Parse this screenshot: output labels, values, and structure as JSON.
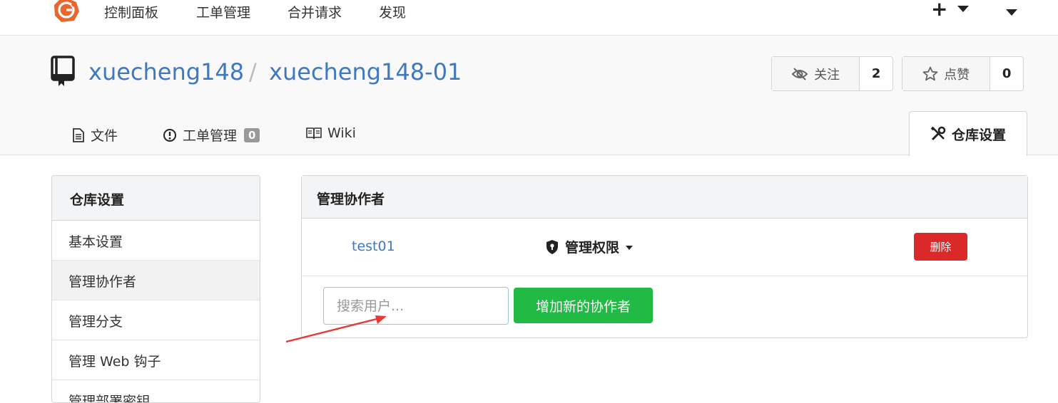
{
  "topnav": {
    "items": [
      "控制面板",
      "工单管理",
      "合并请求",
      "发现"
    ],
    "plus": "+"
  },
  "repo": {
    "owner": "xuecheng148",
    "separator": "/",
    "name": "xuecheng148-01",
    "watch": {
      "label": "关注",
      "count": "2"
    },
    "star": {
      "label": "点赞",
      "count": "0"
    }
  },
  "tabs": {
    "files": "文件",
    "issues": "工单管理",
    "issues_count": "0",
    "wiki": "Wiki",
    "settings": "仓库设置"
  },
  "sidebar": {
    "title": "仓库设置",
    "items": [
      "基本设置",
      "管理协作者",
      "管理分支",
      "管理 Web 钩子",
      "管理部署密钥"
    ],
    "active_index": 1
  },
  "main": {
    "title": "管理协作者",
    "collaborator": {
      "name": "test01",
      "permission": "管理权限",
      "delete_label": "删除"
    },
    "search_placeholder": "搜索用户...",
    "add_button": "增加新的协作者"
  },
  "colors": {
    "link": "#4078c0",
    "danger": "#db2828",
    "success": "#21ba45",
    "logo": "#e9662e",
    "annotation_arrow": "#e53935"
  }
}
